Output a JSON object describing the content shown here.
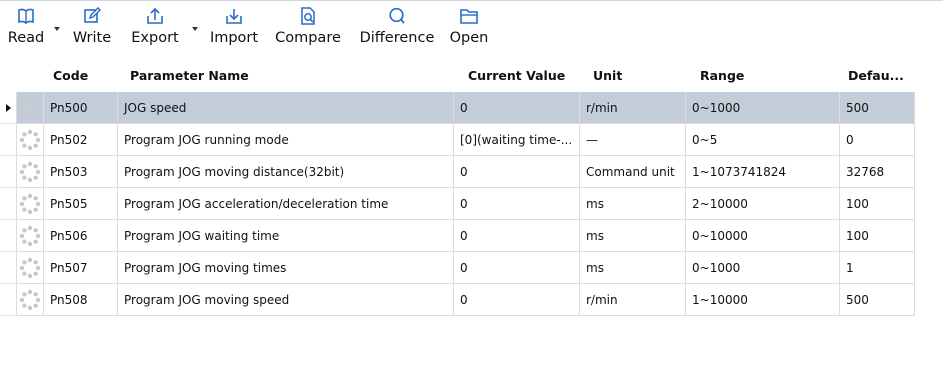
{
  "toolbar": {
    "read": "Read",
    "write": "Write",
    "export": "Export",
    "import": "Import",
    "compare": "Compare",
    "difference": "Difference",
    "open": "Open"
  },
  "columns": {
    "code": "Code",
    "name": "Parameter Name",
    "current": "Current Value",
    "unit": "Unit",
    "range": "Range",
    "default": "Defau..."
  },
  "rows": [
    {
      "code": "Pn500",
      "name": "JOG speed",
      "current": "0",
      "unit": "r/min",
      "range": "0~1000",
      "default": "500"
    },
    {
      "code": "Pn502",
      "name": "Program JOG running mode",
      "current": "[0](waiting time-...",
      "unit": "—",
      "range": "0~5",
      "default": "0"
    },
    {
      "code": "Pn503",
      "name": "Program JOG moving distance(32bit)",
      "current": "0",
      "unit": "Command unit",
      "range": "1~1073741824",
      "default": "32768"
    },
    {
      "code": "Pn505",
      "name": "Program JOG acceleration/deceleration time",
      "current": "0",
      "unit": "ms",
      "range": "2~10000",
      "default": "100"
    },
    {
      "code": "Pn506",
      "name": "Program JOG waiting time",
      "current": "0",
      "unit": "ms",
      "range": "0~10000",
      "default": "100"
    },
    {
      "code": "Pn507",
      "name": "Program JOG moving times",
      "current": "0",
      "unit": "ms",
      "range": "0~1000",
      "default": "1"
    },
    {
      "code": "Pn508",
      "name": "Program JOG moving speed",
      "current": "0",
      "unit": "r/min",
      "range": "1~10000",
      "default": "500"
    }
  ],
  "colors": {
    "accent": "#2b6cc4",
    "selected_row": "#c3ccd9"
  }
}
